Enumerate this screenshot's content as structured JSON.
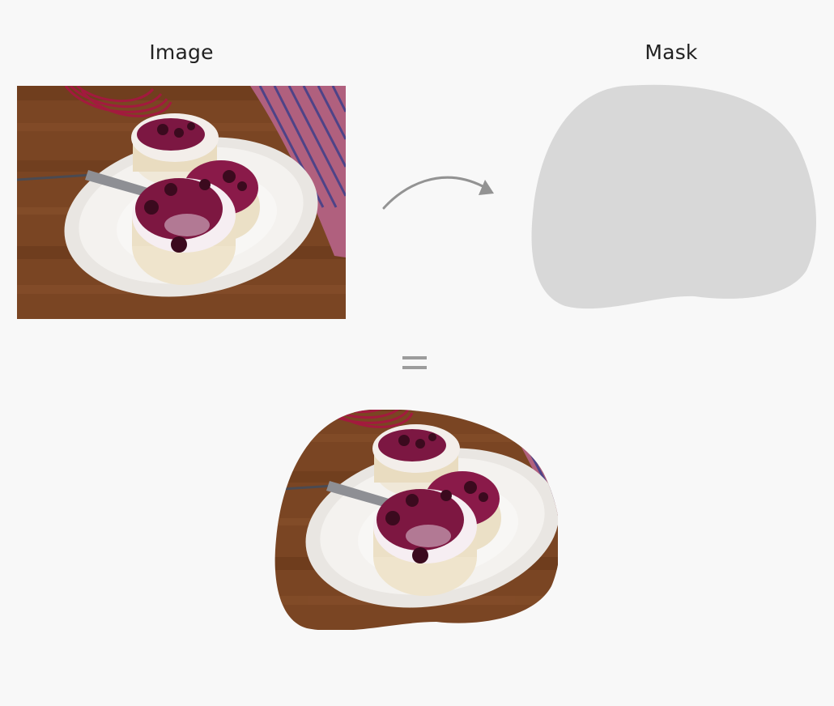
{
  "labels": {
    "image": "Image",
    "mask": "Mask"
  },
  "colors": {
    "background": "#f8f8f8",
    "mask_fill": "#d8d8d8",
    "arrow": "#939393",
    "equals": "#9c9c9c",
    "wood": "#7a4523",
    "plate": "#f1efec",
    "berry_topping": "#7c1742",
    "towel": "#b0607e"
  },
  "icons": {
    "arrow": "curved-arrow-icon",
    "equals": "equals-icon"
  }
}
